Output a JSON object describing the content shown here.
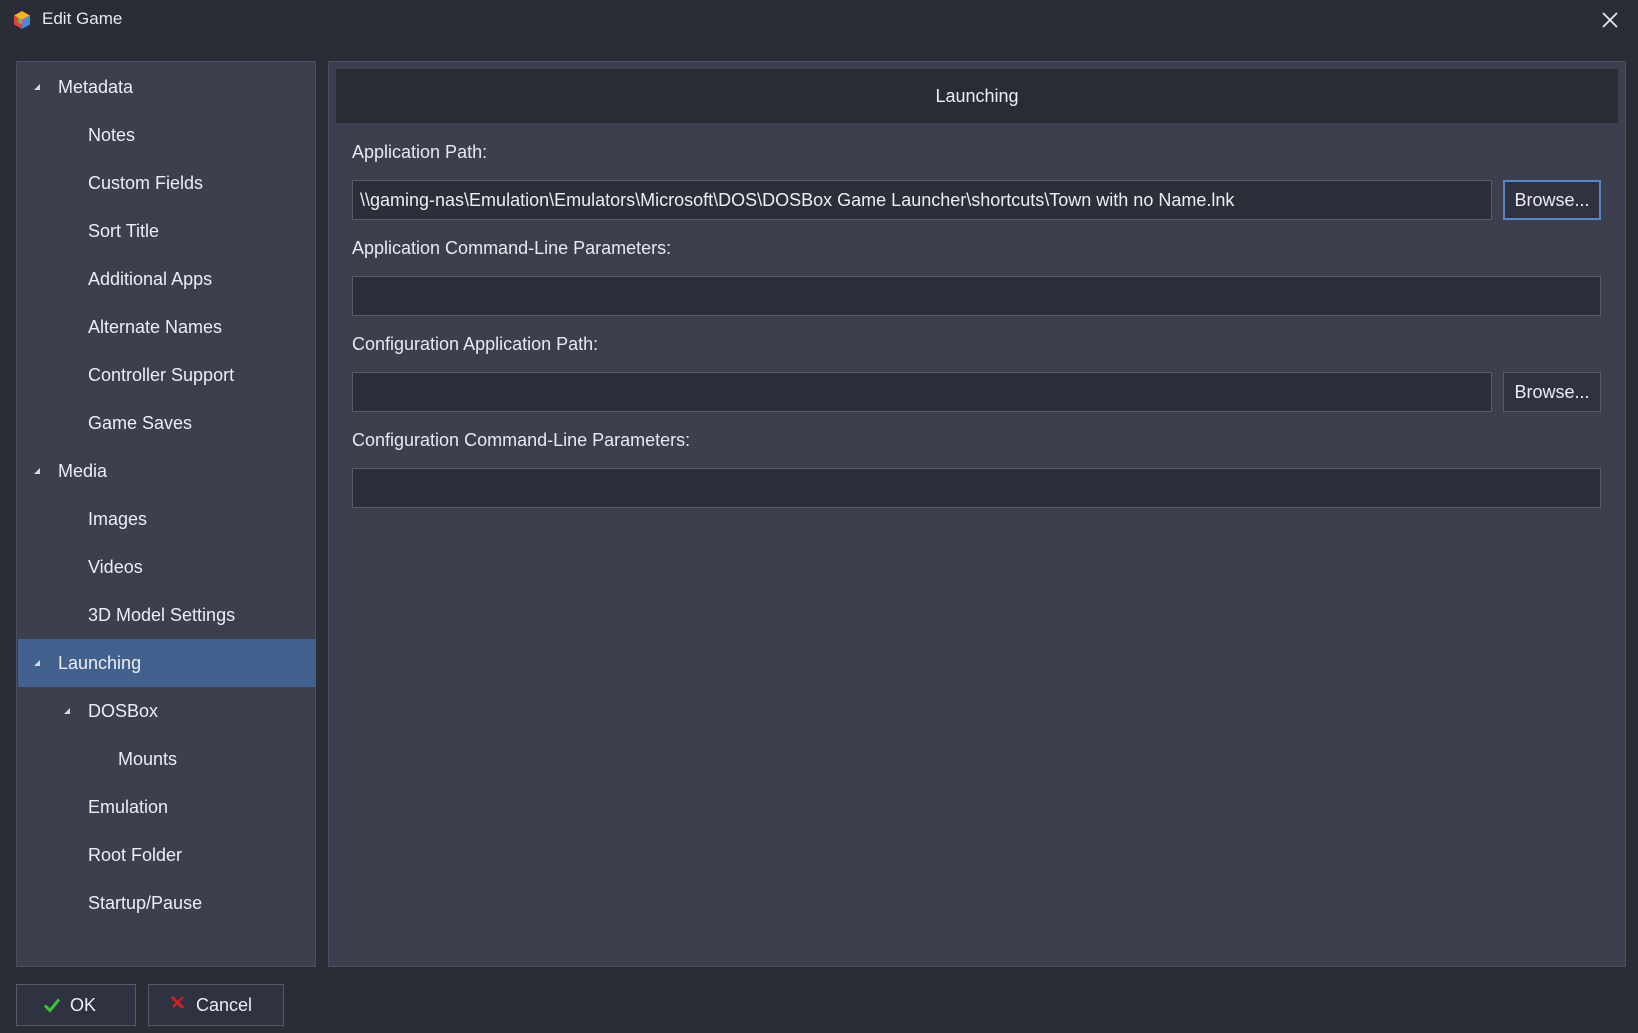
{
  "window": {
    "title": "Edit Game",
    "icon": "app-logo-icon",
    "close_icon": "close-icon"
  },
  "sidebar": {
    "items": [
      {
        "label": "Metadata",
        "level": 0,
        "expandable": true,
        "expanded": true,
        "selected": false
      },
      {
        "label": "Notes",
        "level": 1,
        "expandable": false,
        "selected": false
      },
      {
        "label": "Custom Fields",
        "level": 1,
        "expandable": false,
        "selected": false
      },
      {
        "label": "Sort Title",
        "level": 1,
        "expandable": false,
        "selected": false
      },
      {
        "label": "Additional Apps",
        "level": 1,
        "expandable": false,
        "selected": false
      },
      {
        "label": "Alternate Names",
        "level": 1,
        "expandable": false,
        "selected": false
      },
      {
        "label": "Controller Support",
        "level": 1,
        "expandable": false,
        "selected": false
      },
      {
        "label": "Game Saves",
        "level": 1,
        "expandable": false,
        "selected": false
      },
      {
        "label": "Media",
        "level": 0,
        "expandable": true,
        "expanded": true,
        "selected": false
      },
      {
        "label": "Images",
        "level": 1,
        "expandable": false,
        "selected": false
      },
      {
        "label": "Videos",
        "level": 1,
        "expandable": false,
        "selected": false
      },
      {
        "label": "3D Model Settings",
        "level": 1,
        "expandable": false,
        "selected": false
      },
      {
        "label": "Launching",
        "level": 0,
        "expandable": true,
        "expanded": true,
        "selected": true
      },
      {
        "label": "DOSBox",
        "level": 1,
        "expandable": true,
        "expanded": true,
        "selected": false
      },
      {
        "label": "Mounts",
        "level": 2,
        "expandable": false,
        "selected": false
      },
      {
        "label": "Emulation",
        "level": 1,
        "expandable": false,
        "selected": false
      },
      {
        "label": "Root Folder",
        "level": 1,
        "expandable": false,
        "selected": false
      },
      {
        "label": "Startup/Pause",
        "level": 1,
        "expandable": false,
        "selected": false
      }
    ],
    "selected_color": "#43618f"
  },
  "main": {
    "section_title": "Launching",
    "fields": {
      "app_path": {
        "label": "Application Path:",
        "value": "\\\\gaming-nas\\Emulation\\Emulators\\Microsoft\\DOS\\DOSBox Game Launcher\\shortcuts\\Town with no Name.lnk",
        "browse_label": "Browse..."
      },
      "app_params": {
        "label": "Application Command-Line Parameters:",
        "value": ""
      },
      "config_path": {
        "label": "Configuration Application Path:",
        "value": "",
        "browse_label": "Browse..."
      },
      "config_params": {
        "label": "Configuration Command-Line Parameters:",
        "value": ""
      }
    }
  },
  "footer": {
    "ok_label": "OK",
    "ok_icon": "checkmark-icon",
    "cancel_label": "Cancel",
    "cancel_icon": "cancel-x-icon"
  },
  "colors": {
    "background": "#2a2c36",
    "panel": "#3c3f4e",
    "accent": "#43618f",
    "ok_green": "#3ec23e",
    "cancel_red": "#d42020"
  }
}
